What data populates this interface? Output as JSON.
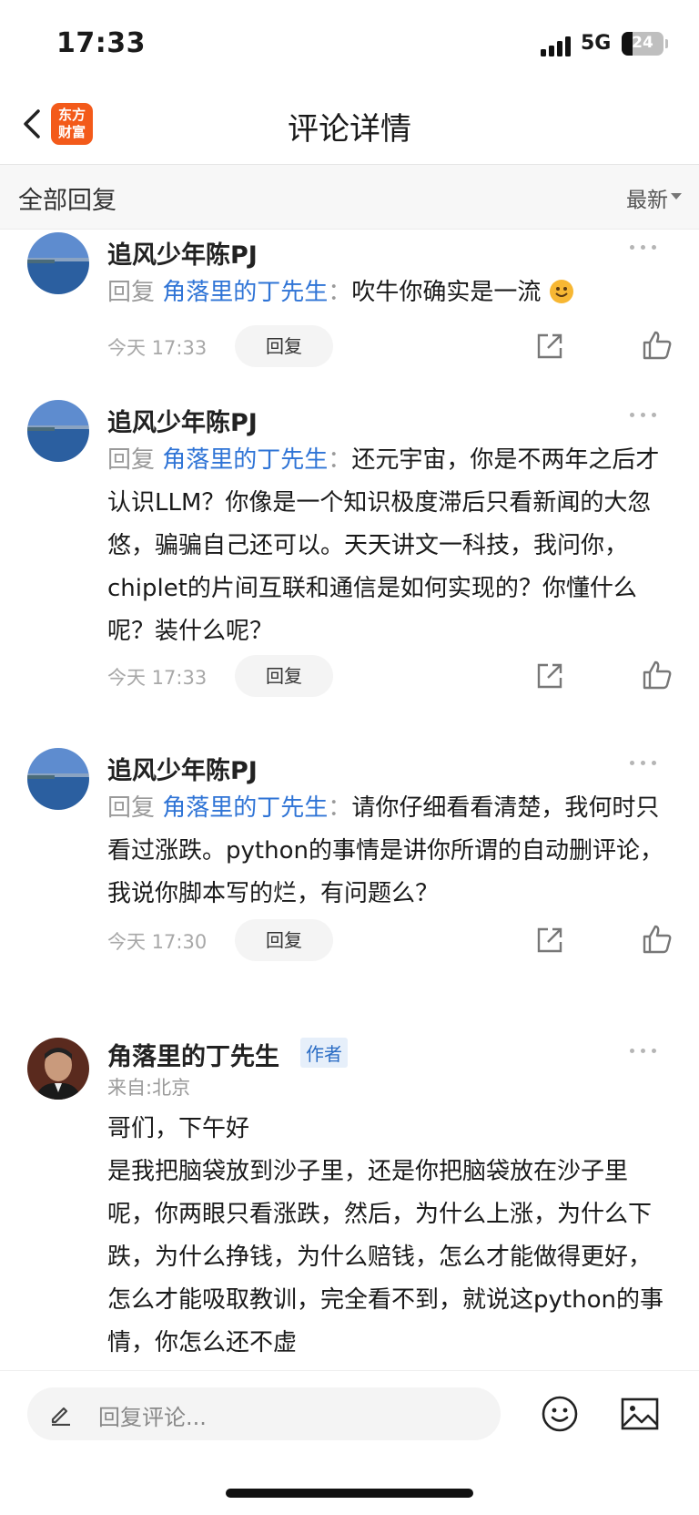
{
  "status": {
    "time": "17:33",
    "network": "5G",
    "battery": "24"
  },
  "nav": {
    "title": "评论详情",
    "logo_line1": "东方",
    "logo_line2": "财富"
  },
  "filter": {
    "title": "全部回复",
    "sort": "最新"
  },
  "comments": [
    {
      "name": "追风少年陈PJ",
      "reply_prefix": "回复",
      "mention": "角落里的丁先生",
      "colon": "：",
      "text": "吹牛你确实是一流",
      "emoji": "smile-emoji",
      "time": "今天 17:33",
      "reply_label": "回复"
    },
    {
      "name": "追风少年陈PJ",
      "reply_prefix": "回复",
      "mention": "角落里的丁先生",
      "colon": "：",
      "text": "还元宇宙，你是不两年之后才认识LLM？你像是一个知识极度滞后只看新闻的大忽悠，骗骗自己还可以。天天讲文一科技，我问你，chiplet的片间互联和通信是如何实现的？你懂什么呢？装什么呢？",
      "time": "今天 17:33",
      "reply_label": "回复"
    },
    {
      "name": "追风少年陈PJ",
      "reply_prefix": "回复",
      "mention": "角落里的丁先生",
      "colon": "：",
      "text": "请你仔细看看清楚，我何时只看过涨跌。python的事情是讲你所谓的自动删评论，我说你脚本写的烂，有问题么？",
      "time": "今天 17:30",
      "reply_label": "回复"
    },
    {
      "name": "角落里的丁先生",
      "badge": "作者",
      "location": "来自:北京",
      "line1": "哥们，下午好",
      "text": "是我把脑袋放到沙子里，还是你把脑袋放在沙子里呢，你两眼只看涨跌，然后，为什么上涨，为什么下跌，为什么挣钱，为什么赔钱，怎么才能做得更好，怎么才能吸取教训，完全看不到，就说这python的事情，你怎么还不虚"
    }
  ],
  "reply_bar": {
    "placeholder": "回复评论..."
  },
  "colors": {
    "accent": "#2f74d6",
    "logo": "#f35a1a"
  }
}
